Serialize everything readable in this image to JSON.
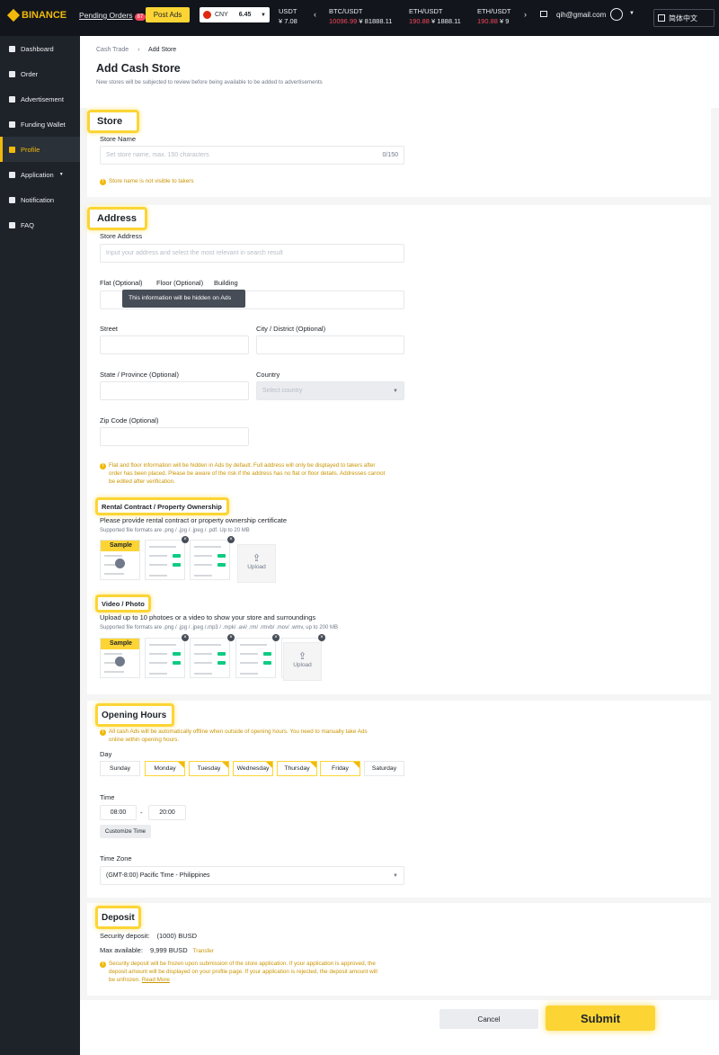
{
  "topbar": {
    "logo": "BINANCE",
    "pending_orders": "Pending Orders",
    "pending_count": "87",
    "post_ads": "Post Ads",
    "currency": "CNY",
    "currency_rate": "6.45",
    "usdt_label": "USDT",
    "usdt_value": "¥ 7.08",
    "tickers": [
      {
        "pair": "BTC/USDT",
        "price": "10096.99",
        "cny": "¥ 81888.11"
      },
      {
        "pair": "ETH/USDT",
        "price": "190.88",
        "cny": "¥ 1888.11"
      },
      {
        "pair": "ETH/USDT",
        "price": "190.88",
        "cny": "¥ 9"
      }
    ],
    "email": "qih@gmail.com",
    "language": "简体中文"
  },
  "sidebar": {
    "items": [
      {
        "label": "Dashboard",
        "icon": "grid-icon"
      },
      {
        "label": "Order",
        "icon": "document-icon"
      },
      {
        "label": "Advertisement",
        "icon": "megaphone-icon"
      },
      {
        "label": "Funding Wallet",
        "icon": "wallet-icon"
      },
      {
        "label": "Profile",
        "icon": "user-icon"
      },
      {
        "label": "Application",
        "icon": "apps-icon"
      },
      {
        "label": "Notification",
        "icon": "bell-icon"
      },
      {
        "label": "FAQ",
        "icon": "help-icon"
      }
    ]
  },
  "breadcrumb": {
    "parent": "Cash Trade",
    "current": "Add Store"
  },
  "page": {
    "title": "Add Cash Store",
    "subtitle": "New stores will be subjected to review before being available to be added to advertisements"
  },
  "store": {
    "section_title": "Store",
    "name_label": "Store Name",
    "name_placeholder": "Set store name, max. 150 characters",
    "name_counter": "0/150",
    "name_note": "Store name is not visible to takers"
  },
  "address": {
    "section_title": "Address",
    "store_address_label": "Store Address",
    "store_address_placeholder": "Input your address and select the most relevant in search result",
    "flat_label": "Flat (Optional)",
    "floor_label": "Floor (Optional)",
    "building_label": "Building",
    "tooltip": "This information will be hidden on Ads",
    "street_label": "Street",
    "city_label": "City / District (Optional)",
    "state_label": "State / Province  (Optional)",
    "country_label": "Country",
    "country_placeholder": "Select country",
    "zip_label": "Zip Code (Optional)",
    "note_lines": [
      "Flat and floor information will be hidden in Ads by default. Full address will only be displayed to takers after",
      "order has been placed. Please be aware of the risk if the address has no flat or floor details. Addresses cannot",
      "be edited after verification."
    ]
  },
  "rental": {
    "section_title": "Rental Contract / Property Ownership",
    "description": "Please provide rental contract or property ownership certificate",
    "formats": "Supported file formats are .png / .jpg / .jpeg / .pdf. Up to 20 MB",
    "sample_label": "Sample",
    "upload_label": "Upload"
  },
  "video": {
    "section_title": "Video / Photo",
    "description": "Upload up to 10 photoes or a video to show your store and surroundings",
    "formats": "Supported file formats are .png / .jpg / .jpeg /.mp3 / .mpk/ .avi/ .rm/ .rmvb/ .mov/ .wmv, up to 200 MB",
    "sample_label": "Sample",
    "upload_label": "Upload"
  },
  "hours": {
    "section_title": "Opening Hours",
    "note_lines": [
      "All cash Ads will be automatically offline when outside of opening hours. You need to manually take Ads",
      "online within opening hours."
    ],
    "day_label": "Day",
    "days": [
      {
        "name": "Sunday",
        "selected": false
      },
      {
        "name": "Monday",
        "selected": true
      },
      {
        "name": "Tuesday",
        "selected": true
      },
      {
        "name": "Wednesday",
        "selected": true
      },
      {
        "name": "Thursday",
        "selected": true
      },
      {
        "name": "Friday",
        "selected": true
      },
      {
        "name": "Saturday",
        "selected": false
      }
    ],
    "time_label": "Time",
    "start_time": "08:00",
    "time_separator": "-",
    "end_time": "20:00",
    "customize_time": "Customize Time",
    "timezone_label": "Time Zone",
    "timezone_value": "(GMT-8:00) Pacific Time - Philippines"
  },
  "deposit": {
    "section_title": "Deposit",
    "security_label": "Security deposit:",
    "security_value": "(1000) BUSD",
    "max_label": "Max available:",
    "max_value": "9,999 BUSD",
    "transfer": "Transfer",
    "note_lines": [
      "Security deposit will be frozen upon submission of the store application. If your application is approved, the",
      "deposit amount will be displayed on your profile page. If your application is rejected, the deposit amount will",
      "be unfrozen."
    ],
    "read_more": "Read More"
  },
  "actions": {
    "cancel": "Cancel",
    "submit": "Submit"
  },
  "colors": {
    "accent": "#FCD535",
    "brand": "#F0B90B",
    "topbar": "#12161C",
    "sidebar": "#1E2329",
    "down": "#F6465D",
    "warning": "#C99400"
  }
}
